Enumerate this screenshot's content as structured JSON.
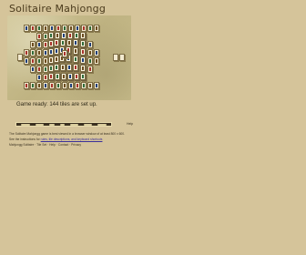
{
  "page": {
    "title": "Solitaire Mahjongg"
  },
  "game": {
    "status_text": "Game ready: 144 tiles are set up.",
    "help_label": "Help"
  },
  "toolbar": {
    "buttons": [
      "New Game",
      "Restart",
      "Undo",
      "Hint",
      "Shuffle",
      "Layout",
      "Options"
    ]
  },
  "footer": {
    "line1": "The Solitaire Mahjongg game is best viewed in a browser window of at least 800 x 600.",
    "line2_prefix": "See the instructions for ",
    "line2_link": "rules, tile descriptions, and keyboard shortcuts",
    "line3": "Mahjongg Solitaire · Tile Set · Help · Contact · Privacy"
  },
  "colors": {
    "background": "#d5c49a",
    "tile_face": "#f2ead0",
    "tile_edge": "#7c6c44",
    "link": "#3a2f9a"
  }
}
